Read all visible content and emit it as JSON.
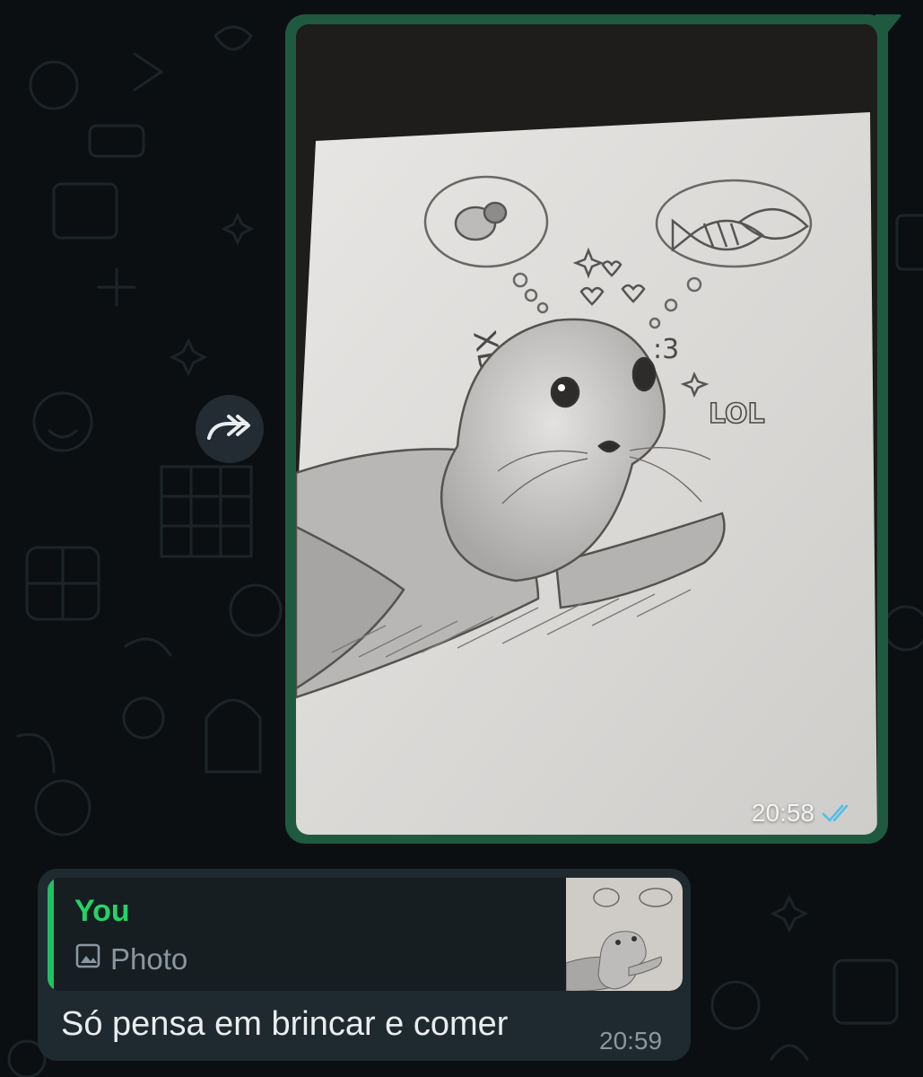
{
  "messages": {
    "outgoing_image": {
      "time": "20:58",
      "status_icon": "double-check-read-icon",
      "drawing_texts": {
        "xd": "XD",
        "face": ":3",
        "lol": "LOL"
      }
    },
    "forward_button": {
      "icon": "forward-icon"
    },
    "incoming_reply": {
      "quoted_author": "You",
      "quoted_type": "Photo",
      "quoted_type_icon": "image-icon",
      "text": "Só pensa em brincar e comer",
      "time": "20:59"
    }
  },
  "colors": {
    "background": "#0b0f12",
    "outgoing_bubble": "#1f5a40",
    "incoming_bubble": "#1f2a30",
    "quote_accent": "#21c063",
    "read_ticks": "#53bdeb"
  }
}
